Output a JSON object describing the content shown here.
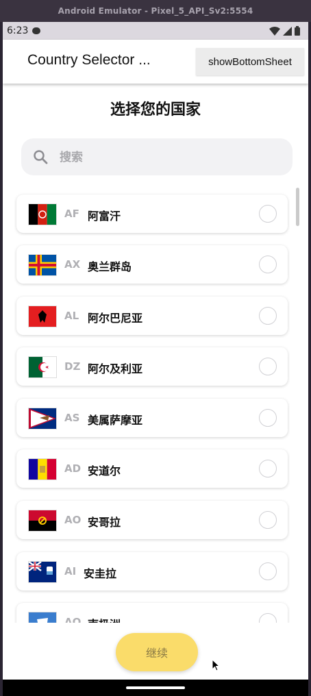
{
  "window": {
    "title": "Android Emulator - Pixel_5_API_Sv2:5554"
  },
  "status_bar": {
    "time": "6:23"
  },
  "app_bar": {
    "title": "Country Selector ...",
    "sheet_button_label": "showBottomSheet"
  },
  "heading": "选择您的国家",
  "search": {
    "placeholder": "搜索",
    "value": ""
  },
  "countries": [
    {
      "code": "AF",
      "name": "阿富汗",
      "selected": false
    },
    {
      "code": "AX",
      "name": "奥兰群岛",
      "selected": false
    },
    {
      "code": "AL",
      "name": "阿尔巴尼亚",
      "selected": false
    },
    {
      "code": "DZ",
      "name": "阿尔及利亚",
      "selected": false
    },
    {
      "code": "AS",
      "name": "美属萨摩亚",
      "selected": false
    },
    {
      "code": "AD",
      "name": "安道尔",
      "selected": false
    },
    {
      "code": "AO",
      "name": "安哥拉",
      "selected": false
    },
    {
      "code": "AI",
      "name": "安圭拉",
      "selected": false
    },
    {
      "code": "AQ",
      "name": "南极洲",
      "selected": false
    }
  ],
  "continue_label": "继续",
  "colors": {
    "accent": "#fadc6a",
    "code_gray": "#b0b0b4"
  }
}
